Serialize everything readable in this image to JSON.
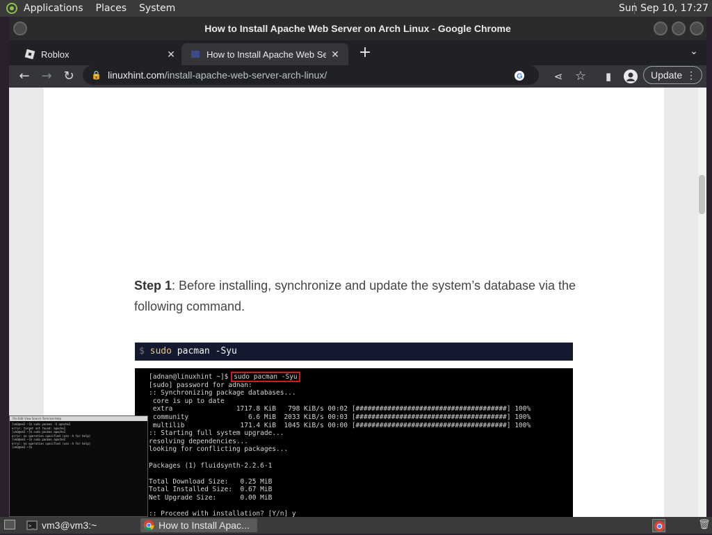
{
  "top_panel": {
    "menus": [
      "Applications",
      "Places",
      "System"
    ],
    "clock": "Sun Sep 10, 17:27"
  },
  "window": {
    "title": "How to Install Apache Web Server on Arch Linux - Google Chrome"
  },
  "tabs": [
    {
      "title": "Roblox",
      "active": false
    },
    {
      "title": "How to Install Apache Web Se",
      "active": true
    }
  ],
  "toolbar": {
    "url_domain": "linuxhint.com",
    "url_path": "/install-apache-web-server-arch-linux/",
    "update_label": "Update"
  },
  "article": {
    "step_label": "Step 1",
    "step_text": ": Before installing, synchronize and update the system’s database via the following command.",
    "command_prompt": "$",
    "command_sudo": "sudo",
    "command_rest": " pacman -Syu"
  },
  "terminal_image": {
    "prompt": "[adnan@linuxhint ~]$",
    "command": "sudo pacman -Syu",
    "lines": [
      "[sudo] password for adnan:",
      ":: Synchronizing package databases...",
      " core is up to date",
      " extra                1717.8 KiB   798 KiB/s 00:02 [######################################] 100%",
      " community               6.6 MiB  2033 KiB/s 00:03 [######################################] 100%",
      " multilib              171.4 KiB  1045 KiB/s 00:00 [######################################] 100%",
      ":: Starting full system upgrade...",
      "resolving dependencies...",
      "looking for conflicting packages...",
      "",
      "Packages (1) fluidsynth-2.2.6-1",
      "",
      "Total Download Size:   0.25 MiB",
      "Total Installed Size:  0.67 MiB",
      "Net Upgrade Size:      0.00 MiB",
      "",
      ":: Proceed with installation? [Y/n] y"
    ]
  },
  "terminal_preview": {
    "menus": "File  Edit  View  Search  Terminal  Help",
    "lines": [
      "[vm3@vm3 ~]$ sudo pacman -S apache2",
      "error: target not found: apache2",
      "[vm3@vm3 ~]$ sudo pacman apache2",
      "error: no operation specified (use -h for help)",
      "[vm3@vm3 ~]$ sudo pacman apache2",
      "error: no operation specified (use -h for help)",
      "[vm3@vm3 ~]$ "
    ]
  },
  "taskbar": {
    "terminal_task": "vm3@vm3:~",
    "chrome_task": "How to Install Apac..."
  }
}
